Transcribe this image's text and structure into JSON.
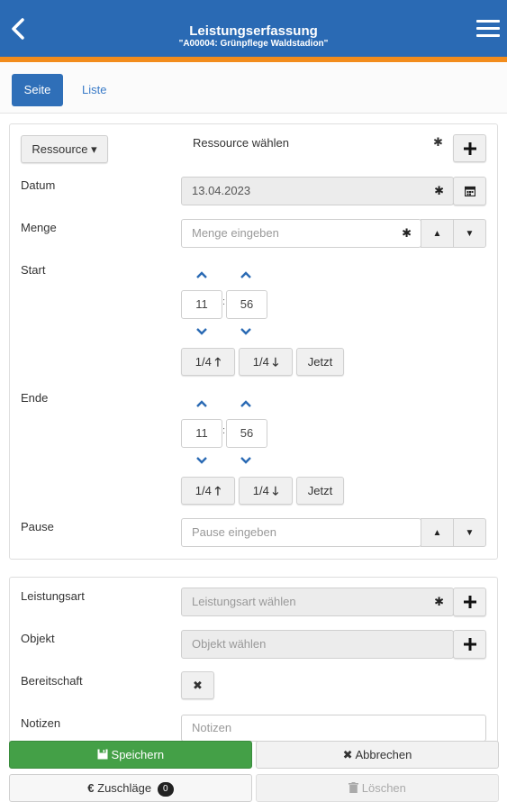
{
  "header": {
    "title": "Leistungserfassung",
    "subtitle": "\"A00004: Grünpflege Waldstadion\""
  },
  "tabs": {
    "active": "Seite",
    "other": "Liste"
  },
  "ressource": {
    "button": "Ressource ▾",
    "value": "Ressource wählen",
    "required": "✱"
  },
  "datum": {
    "label": "Datum",
    "value": "13.04.2023",
    "required": "✱"
  },
  "menge": {
    "label": "Menge",
    "placeholder": "Menge eingeben",
    "required": "✱"
  },
  "start": {
    "label": "Start",
    "hour": "11",
    "minute": "56",
    "colon": ":",
    "btn_up": "1/4",
    "btn_down": "1/4",
    "btn_now": "Jetzt"
  },
  "ende": {
    "label": "Ende",
    "hour": "11",
    "minute": "56",
    "colon": ":",
    "btn_up": "1/4",
    "btn_down": "1/4",
    "btn_now": "Jetzt"
  },
  "pause": {
    "label": "Pause",
    "placeholder": "Pause eingeben"
  },
  "leistungsart": {
    "label": "Leistungsart",
    "placeholder": "Leistungsart wählen",
    "required": "✱"
  },
  "objekt": {
    "label": "Objekt",
    "placeholder": "Objekt wählen"
  },
  "bereitschaft": {
    "label": "Bereitschaft",
    "mark": "✖"
  },
  "notizen": {
    "label": "Notizen",
    "placeholder": "Notizen"
  },
  "footer": {
    "save": "Speichern",
    "cancel": "Abbrechen",
    "surcharges": "Zuschläge",
    "surcharges_count": "0",
    "delete": "Löschen"
  },
  "colors": {
    "header": "#2a6ab4",
    "accent": "#f28c1c",
    "save": "#44a047",
    "link": "#3a7bc8"
  }
}
